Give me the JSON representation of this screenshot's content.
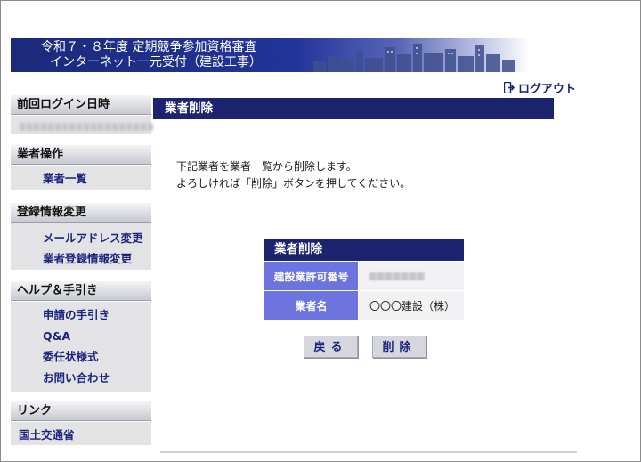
{
  "header": {
    "title_line1": "令和７・８年度 定期競争参加資格審査",
    "title_line2": "インターネット一元受付（建設工事）"
  },
  "logout": {
    "label": "ログアウト"
  },
  "sidebar": {
    "last_login": {
      "heading": "前回ログイン日時"
    },
    "vendor_ops": {
      "heading": "業者操作",
      "items": [
        {
          "label": "業者一覧"
        }
      ]
    },
    "registration": {
      "heading": "登録情報変更",
      "items": [
        {
          "label": "メールアドレス変更"
        },
        {
          "label": "業者登録情報変更"
        }
      ]
    },
    "help": {
      "heading": "ヘルプ＆手引き",
      "items": [
        {
          "label": "申請の手引き"
        },
        {
          "label": "Q&A"
        },
        {
          "label": "委任状様式"
        },
        {
          "label": "お問い合わせ"
        }
      ]
    },
    "links": {
      "heading": "リンク",
      "items": [
        {
          "label": "国土交通省"
        }
      ]
    }
  },
  "main": {
    "section_title": "業者削除",
    "message_line1": "下記業者を業者一覧から削除します。",
    "message_line2": "よろしければ「削除」ボタンを押してください。",
    "table": {
      "title": "業者削除",
      "rows": [
        {
          "label": "建設業許可番号"
        },
        {
          "label": "業者名",
          "value": "〇〇〇建設（株）"
        }
      ]
    },
    "back_button": "戻る",
    "delete_button": "削除"
  },
  "colors": {
    "navy": "#1c2470",
    "label_purple": "#6d74e0",
    "link": "#1a237e"
  }
}
